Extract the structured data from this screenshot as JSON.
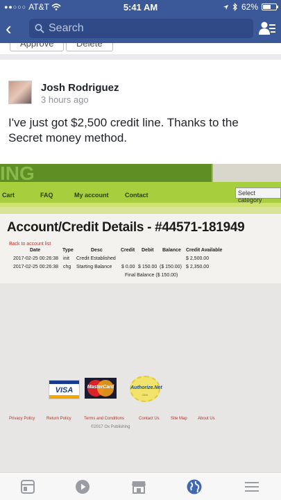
{
  "status_bar": {
    "carrier": "AT&T",
    "time": "5:41 AM",
    "battery": "62%",
    "battery_level": 0.62
  },
  "nav": {
    "search_placeholder": "Search"
  },
  "previous_request": {
    "approve_label": "Approve",
    "delete_label": "Delete"
  },
  "post": {
    "author": "Josh Rodriguez",
    "time_ago": "3 hours ago",
    "text": "I've just got $2,500 credit line. Thanks to the Secret money method."
  },
  "photo": {
    "brand_fragment": "ING",
    "menu": [
      "Cart",
      "FAQ",
      "My account",
      "Contact"
    ],
    "select_category": "Select category",
    "title": "Account/Credit Details - #44571-181949",
    "back_link": "Back to account list",
    "table": {
      "headers": [
        "Date",
        "Type",
        "Desc",
        "Credit",
        "Debit",
        "Balance",
        "Credit Available"
      ],
      "rows": [
        [
          "2017-02-25 00:26:38",
          "init",
          "Credit Established",
          "",
          "",
          "",
          "$ 2,500.00"
        ],
        [
          "2017-02-25 00:26:38",
          "chg",
          "Starting Balance",
          "$ 0.00",
          "$ 150.00",
          "($ 150.00)",
          "$ 2,350.00"
        ]
      ],
      "final_balance": "Final Balance ($ 150.00)"
    },
    "cards": {
      "visa": "VISA",
      "mastercard": "MasterCard",
      "authorize_net": "Authorize.Net",
      "authorize_sub": "Click"
    },
    "footer_links": [
      "Privacy Policy",
      "Return Policy",
      "Terms and Conditions",
      "Contact Us",
      "Site Map",
      "About Us"
    ],
    "copyright": "©2017 Ox Publishing"
  },
  "tabbar": {
    "icons": [
      "news-feed-icon",
      "video-icon",
      "marketplace-icon",
      "notifications-globe-icon",
      "menu-icon"
    ],
    "active_color": "#4267b2",
    "inactive_color": "#999da3"
  },
  "colors": {
    "brand_blue": "#3b5998",
    "site_green": "#a7cf3d",
    "link_red": "#c0302a"
  }
}
